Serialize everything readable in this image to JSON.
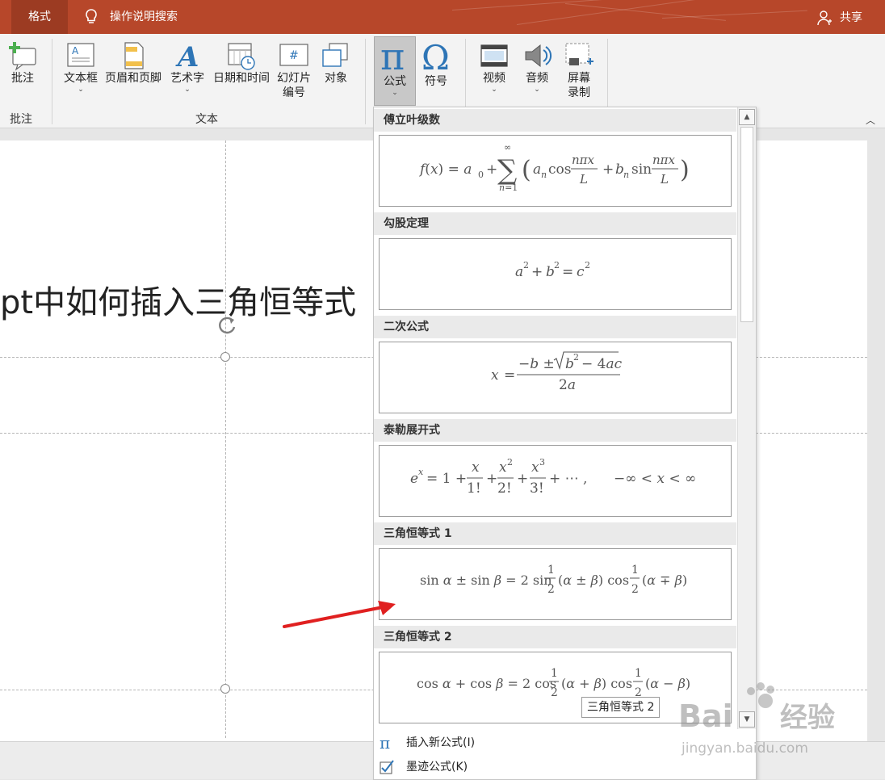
{
  "titlebar": {
    "active_tab": "格式",
    "tell_me": "操作说明搜索",
    "share": "共享",
    "brand_color": "#b7472a"
  },
  "ribbon": {
    "comment_group": {
      "button": "批注",
      "label": "批注"
    },
    "text_group": {
      "label": "文本",
      "buttons": [
        "文本框",
        "页眉和页脚",
        "艺术字",
        "日期和时间",
        "幻灯片",
        "编号",
        "对象"
      ]
    },
    "symbols_group": {
      "equation": "公式",
      "symbol": "符号"
    },
    "media_group": {
      "video": "视频",
      "audio": "音频",
      "screen": "屏幕",
      "record": "录制"
    }
  },
  "slide": {
    "title": "pt中如何插入三角恒等式"
  },
  "equation_gallery": {
    "sections": [
      {
        "name": "傅立叶级数"
      },
      {
        "name": "勾股定理"
      },
      {
        "name": "二次公式"
      },
      {
        "name": "泰勒展开式"
      },
      {
        "name": "三角恒等式 1"
      },
      {
        "name": "三角恒等式 2"
      }
    ],
    "commands": {
      "insert_new": "插入新公式(I)",
      "ink": "墨迹公式(K)"
    },
    "tooltip": "三角恒等式 2"
  },
  "watermark": {
    "brand": "Bai",
    "brand2": "经验",
    "url": "jingyan.baidu.com"
  },
  "colors": {
    "arrow": "#e02020",
    "accent_blue": "#2e75b6"
  }
}
